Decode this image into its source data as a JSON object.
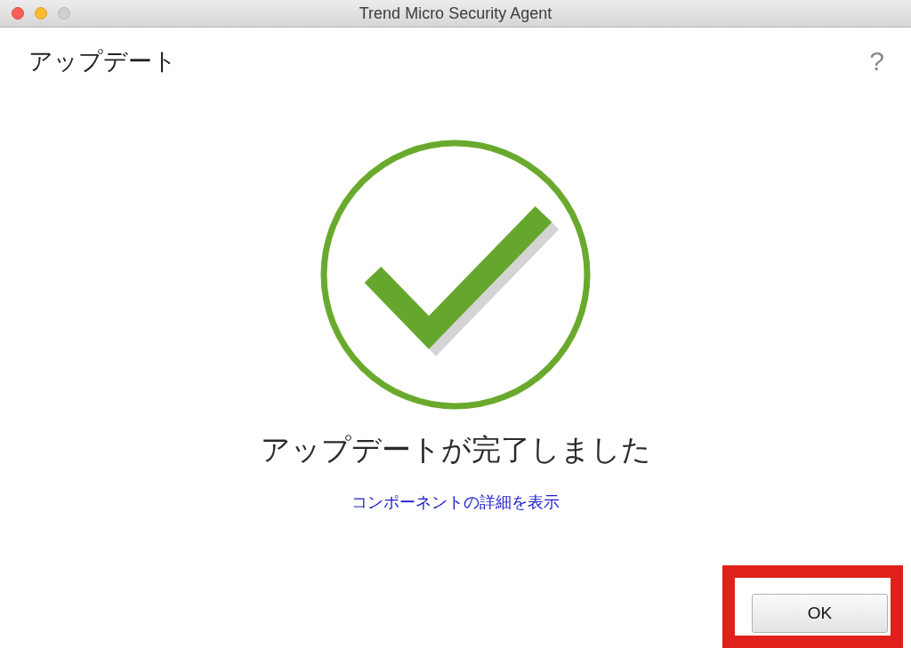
{
  "window": {
    "title": "Trend Micro Security Agent",
    "controls": [
      {
        "kind": "close",
        "disabled": false
      },
      {
        "kind": "minimize",
        "disabled": false
      },
      {
        "kind": "zoom",
        "disabled": true
      }
    ]
  },
  "header": {
    "title": "アップデート",
    "help": "?"
  },
  "result": {
    "message": "アップデートが完了しました",
    "link": "コンポーネントの詳細を表示"
  },
  "buttons": [
    "OK"
  ]
}
